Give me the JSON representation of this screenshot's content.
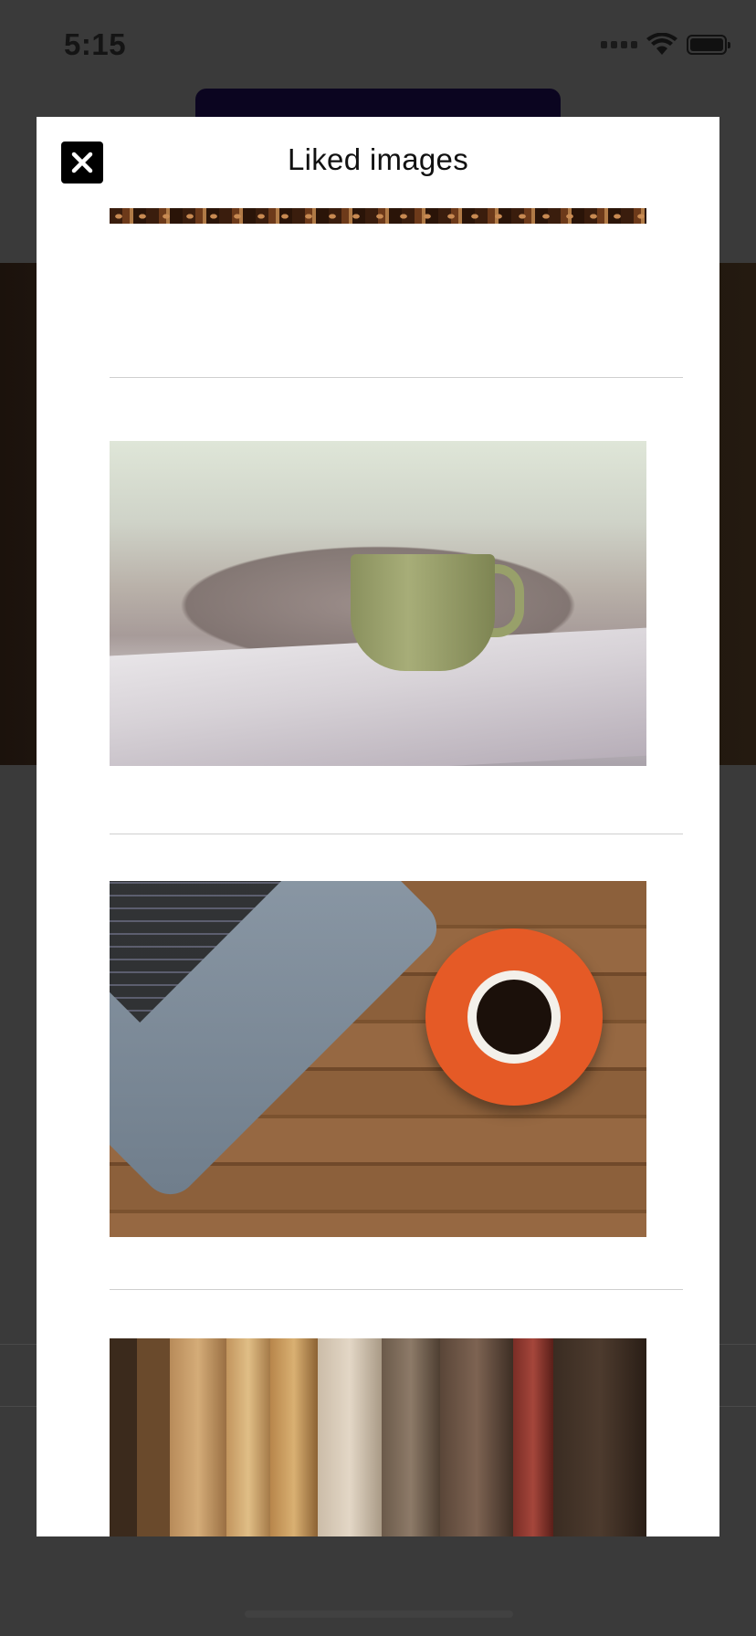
{
  "status_bar": {
    "time": "5:15"
  },
  "modal": {
    "title": "Liked images",
    "close_icon": "close-icon",
    "images": [
      {
        "subject": "coffee beans"
      },
      {
        "subject": "green cup of tea on open book with blanket"
      },
      {
        "subject": "laptop and orange coffee cup on wooden table"
      },
      {
        "subject": "old worn books on shelf"
      }
    ]
  }
}
